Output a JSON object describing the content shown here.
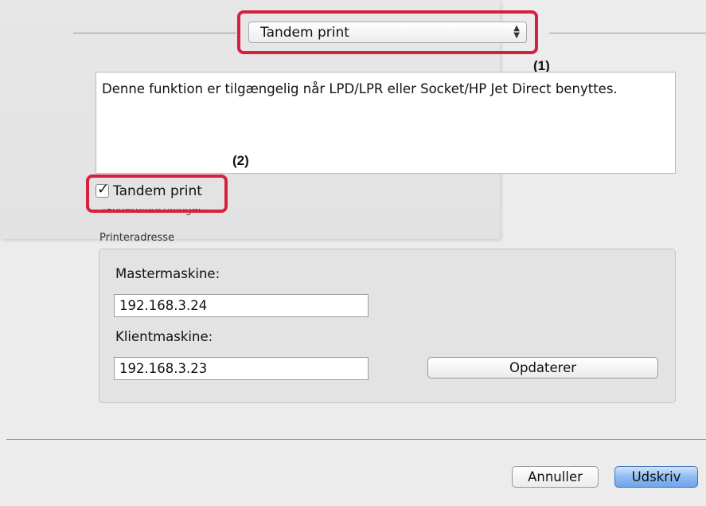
{
  "popup": {
    "label": "Tandem print"
  },
  "callouts": {
    "one": "(1)",
    "two": "(2)"
  },
  "description": "Denne funktion er tilgængelig når LPD/LPR eller Socket/HP Jet Direct benyttes.",
  "checkbox": {
    "label": "Tandem print",
    "checked": true
  },
  "tandem_settings_label": "Tandemindstillinger",
  "printer_address": {
    "group_title": "Printeradresse",
    "master_label": "Mastermaskine:",
    "master_value": "192.168.3.24",
    "client_label": "Klientmaskine:",
    "client_value": "192.168.3.23",
    "update_button": "Opdaterer"
  },
  "footer": {
    "cancel": "Annuller",
    "print": "Udskriv"
  },
  "colors": {
    "highlight": "#d4213d",
    "primary_button": "#6fa4ea"
  }
}
